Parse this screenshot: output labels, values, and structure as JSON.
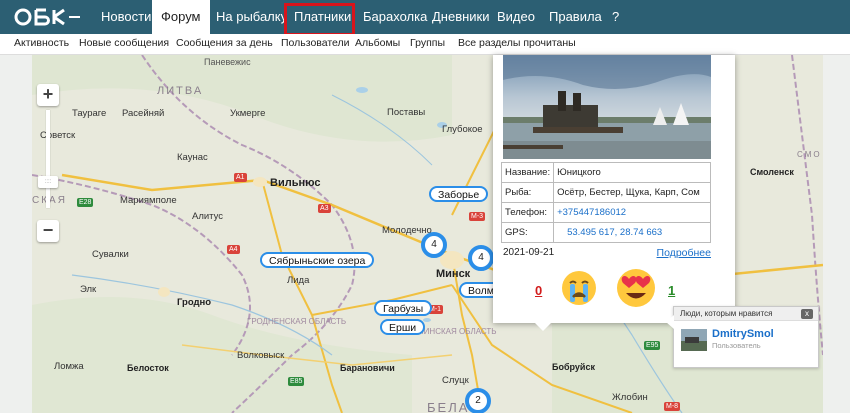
{
  "logo": {
    "text": "ОБК"
  },
  "topnav": {
    "items": [
      {
        "label": "Новости"
      },
      {
        "label": "Форум"
      },
      {
        "label": "На рыбалку"
      },
      {
        "label": "Платники"
      },
      {
        "label": "Барахолка"
      },
      {
        "label": "Дневники"
      },
      {
        "label": "Видео"
      },
      {
        "label": "Правила"
      },
      {
        "label": "?"
      }
    ],
    "active": "Форум",
    "highlighted": "Платники"
  },
  "subnav": {
    "items": [
      {
        "label": "Активность"
      },
      {
        "label": "Новые сообщения"
      },
      {
        "label": "Сообщения за день"
      },
      {
        "label": "Пользователи"
      },
      {
        "label": "Альбомы"
      },
      {
        "label": "Группы"
      },
      {
        "label": "Все разделы прочитаны"
      }
    ]
  },
  "map": {
    "labels": {
      "litva": "ЛИТВА",
      "tauragė": "Таураге",
      "raseiniai": "Расейняй",
      "ukmerge": "Укмерге",
      "postavy": "Поставы",
      "glubokoe": "Глубокое",
      "sovetsk": "Советск",
      "kaunas": "Каунас",
      "vilnius": "Вильнюс",
      "marijampole": "Мариямполе",
      "alytus": "Алитус",
      "molodechno": "Молодечно",
      "suvalki": "Сувалки",
      "lida": "Лида",
      "minsk": "Минск",
      "elk": "Элк",
      "grodno": "Гродно",
      "grodno_region": "ГРОДНЕНСКАЯ ОБЛАСТЬ",
      "minsk_region": "МИНСКАЯ ОБЛАСТЬ",
      "lomzha": "Ломжа",
      "belostok": "Белосток",
      "volkovysk": "Волковыск",
      "baranovichi": "Барановичи",
      "slutsk": "Слуцк",
      "bobruisk": "Бобруйск",
      "zhlobin": "Жлобин",
      "smolensk": "Смоленск",
      "belarus": "БЕЛА",
      "rossiya_cut": "СМО",
      "panevezys": "Паневежис",
      "kaliningrad_cut": "СКАЯ"
    },
    "roads": {
      "a1": "A1",
      "a3": "A3",
      "a4": "A4",
      "e28": "E28",
      "m3": "M-3",
      "m1": "M-1",
      "e95": "E95",
      "e85": "E85",
      "m8": "M-8"
    },
    "pins": {
      "zaborie": "Заборье",
      "sabrinskie": "Сябрыньские озера",
      "volma": "Волма",
      "garbuzy": "Гарбузы",
      "ershi": "Ерши"
    },
    "clusters": {
      "c1": "4",
      "c2": "4",
      "c3": "2"
    },
    "zoom_in": "+",
    "zoom_out": "−"
  },
  "popup": {
    "fields": [
      {
        "key": "Название:",
        "value": "Юницкого"
      },
      {
        "key": "Рыба:",
        "value": "Осётр, Бестер, Щука, Карп, Сом"
      },
      {
        "key": "Телефон:",
        "value": "+375447186012"
      },
      {
        "key": "GPS:",
        "value": "53.495 617, 28.74 663"
      }
    ],
    "date": "2021-09-21",
    "more_link": "Подробнее",
    "reactions": {
      "cry_count": "0",
      "love_count": "1"
    }
  },
  "likes_tooltip": {
    "title": "Люди, которым нравится",
    "close": "x",
    "user_name": "DmitrySmol",
    "user_role": "Пользователь"
  },
  "colors": {
    "topbar": "#2c5f73",
    "highlight": "#d8141b",
    "pin_border": "#2b8ee8",
    "link": "#1a6fc9"
  }
}
